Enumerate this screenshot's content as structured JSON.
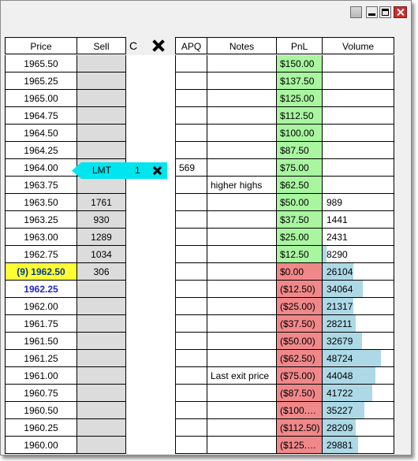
{
  "headers": {
    "price": "Price",
    "sell": "Sell",
    "c": "C",
    "apq": "APQ",
    "notes": "Notes",
    "pnl": "PnL",
    "volume": "Volume"
  },
  "order": {
    "type": "LMT",
    "qty": "1",
    "apq": "569"
  },
  "rows": [
    {
      "price": "1965.50",
      "sell": "",
      "notes": "",
      "pnl": "$150.00",
      "pnl_state": "pos",
      "volume": "",
      "vol_level": 0
    },
    {
      "price": "1965.25",
      "sell": "",
      "notes": "",
      "pnl": "$137.50",
      "pnl_state": "pos",
      "volume": "",
      "vol_level": 0
    },
    {
      "price": "1965.00",
      "sell": "",
      "notes": "",
      "pnl": "$125.00",
      "pnl_state": "pos",
      "volume": "",
      "vol_level": 0
    },
    {
      "price": "1964.75",
      "sell": "",
      "notes": "",
      "pnl": "$112.50",
      "pnl_state": "pos",
      "volume": "",
      "vol_level": 0
    },
    {
      "price": "1964.50",
      "sell": "",
      "notes": "",
      "pnl": "$100.00",
      "pnl_state": "pos",
      "volume": "",
      "vol_level": 0
    },
    {
      "price": "1964.25",
      "sell": "",
      "notes": "",
      "pnl": "$87.50",
      "pnl_state": "pos",
      "volume": "",
      "vol_level": 0
    },
    {
      "price": "1964.00",
      "sell": "",
      "notes": "",
      "pnl": "$75.00",
      "pnl_state": "pos",
      "volume": "",
      "vol_level": 0
    },
    {
      "price": "1963.75",
      "sell": "",
      "notes": "higher highs",
      "pnl": "$62.50",
      "pnl_state": "pos",
      "volume": "",
      "vol_level": 0
    },
    {
      "price": "1963.50",
      "sell": "1761",
      "notes": "",
      "pnl": "$50.00",
      "pnl_state": "pos",
      "volume": "989",
      "vol_level": 0
    },
    {
      "price": "1963.25",
      "sell": "930",
      "notes": "",
      "pnl": "$37.50",
      "pnl_state": "pos",
      "volume": "1441",
      "vol_level": 0
    },
    {
      "price": "1963.00",
      "sell": "1289",
      "notes": "",
      "pnl": "$25.00",
      "pnl_state": "pos",
      "volume": "2431",
      "vol_level": 0
    },
    {
      "price": "1962.75",
      "sell": "1034",
      "notes": "",
      "pnl": "$12.50",
      "pnl_state": "pos",
      "volume": "8290",
      "vol_level": 0.05
    },
    {
      "price": "(9) 1962.50",
      "sell": "306",
      "notes": "",
      "pnl": "$0.00",
      "pnl_state": "zero",
      "volume": "26104",
      "vol_level": 0.43,
      "highlight": "last"
    },
    {
      "price": "1962.25",
      "sell": "",
      "notes": "",
      "pnl": "($12.50)",
      "pnl_state": "neg",
      "volume": "34064",
      "vol_level": 0.57,
      "highlight": "current"
    },
    {
      "price": "1962.00",
      "sell": "",
      "notes": "",
      "pnl": "($25.00)",
      "pnl_state": "neg",
      "volume": "21317",
      "vol_level": 0.43
    },
    {
      "price": "1961.75",
      "sell": "",
      "notes": "",
      "pnl": "($37.50)",
      "pnl_state": "neg",
      "volume": "28211",
      "vol_level": 0.47
    },
    {
      "price": "1961.50",
      "sell": "",
      "notes": "",
      "pnl": "($50.00)",
      "pnl_state": "neg",
      "volume": "32679",
      "vol_level": 0.55
    },
    {
      "price": "1961.25",
      "sell": "",
      "notes": "",
      "pnl": "($62.50)",
      "pnl_state": "neg",
      "volume": "48724",
      "vol_level": 0.82
    },
    {
      "price": "1961.00",
      "sell": "",
      "notes": "Last exit price",
      "pnl": "($75.00)",
      "pnl_state": "neg",
      "volume": "44048",
      "vol_level": 0.74
    },
    {
      "price": "1960.75",
      "sell": "",
      "notes": "",
      "pnl": "($87.50)",
      "pnl_state": "neg",
      "volume": "41722",
      "vol_level": 0.7
    },
    {
      "price": "1960.50",
      "sell": "",
      "notes": "",
      "pnl": "($100.…",
      "pnl_state": "neg",
      "volume": "35227",
      "vol_level": 0.59
    },
    {
      "price": "1960.25",
      "sell": "",
      "notes": "",
      "pnl": "($112.50)",
      "pnl_state": "neg",
      "volume": "28209",
      "vol_level": 0.47
    },
    {
      "price": "1960.00",
      "sell": "",
      "notes": "",
      "pnl": "($125.…",
      "pnl_state": "neg",
      "volume": "29881",
      "vol_level": 0.5
    }
  ],
  "colors": {
    "pnl_positive": "#a9f5a0",
    "pnl_negative": "#f0888a",
    "volume_bar": "#add8e6",
    "order_marker": "#00e5ee",
    "last_price_bg": "#ffff33"
  }
}
